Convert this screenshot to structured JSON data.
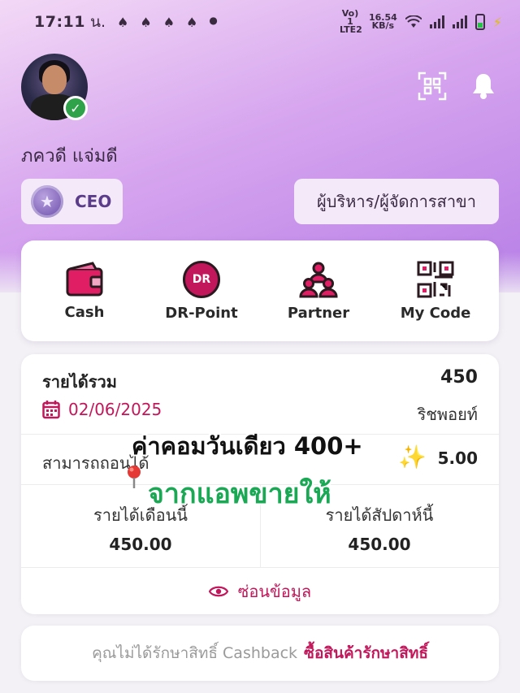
{
  "status_bar": {
    "time": "17:11",
    "period": "น.",
    "network_line1": "Vo) 1 LTE2",
    "speed_value": "16.54",
    "speed_unit": "KB/s"
  },
  "profile": {
    "name": "ภควดี แจ่มดี",
    "rank": "CEO",
    "role": "ผู้บริหาร/ผู้จัดการสาขา"
  },
  "quick_menu": [
    {
      "label": "Cash",
      "icon": "wallet-icon"
    },
    {
      "label": "DR-Point",
      "icon": "dr-point-icon",
      "badge": "DR"
    },
    {
      "label": "Partner",
      "icon": "partner-icon"
    },
    {
      "label": "My Code",
      "icon": "qr-code-icon"
    }
  ],
  "income": {
    "title": "รายได้รวม",
    "total": "450",
    "date": "02/06/2025",
    "unit": "ริชพอยท์",
    "withdrawable_label": "สามารถถอนได้",
    "withdrawable_value": "5.00",
    "month_label": "รายได้เดือนนี้",
    "month_value": "450.00",
    "week_label": "รายได้สัปดาห์นี้",
    "week_value": "450.00",
    "hide_label": "ซ่อนข้อมูล"
  },
  "promo_overlay": {
    "line1": "ค่าคอมวันเดียว 400+",
    "line2": "จากแอพขายให้"
  },
  "cashback_banner": {
    "message": "คุณไม่ได้รักษาสิทธิ์ Cashback",
    "cta": "ซื้อสินค้ารักษาสิทธิ์"
  },
  "colors": {
    "accent": "#c2185b",
    "hero_gradient_start": "#f3d9f6",
    "hero_gradient_end": "#b67ee6",
    "promo_green": "#1aa855"
  }
}
